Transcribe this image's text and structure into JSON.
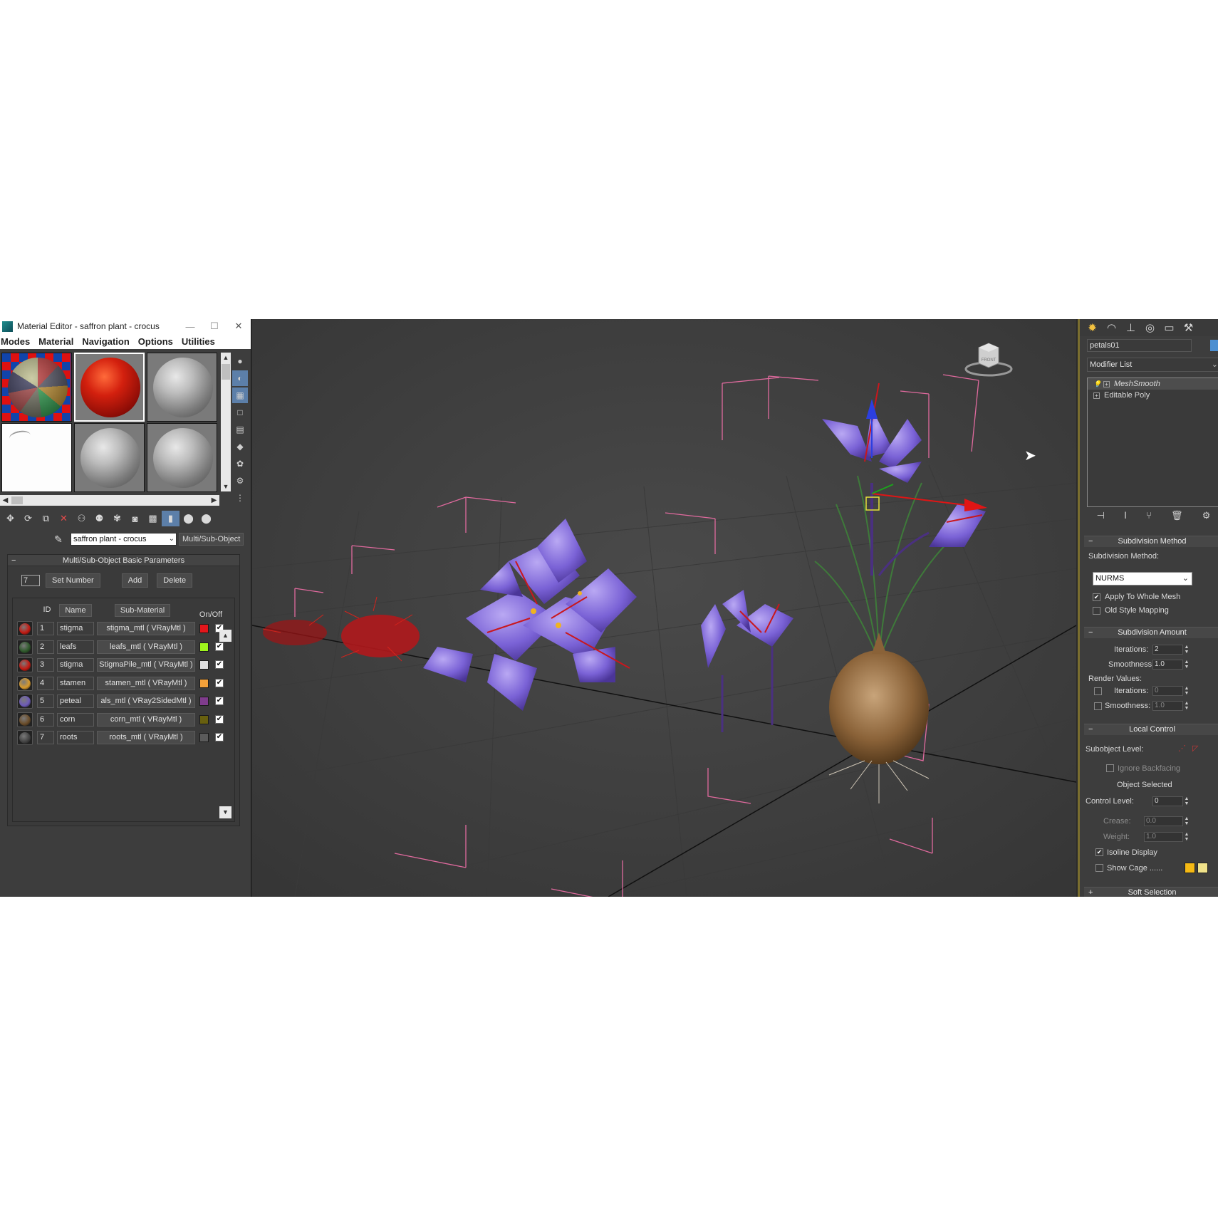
{
  "material_editor": {
    "title": "Material Editor - saffron plant - crocus",
    "window_buttons": [
      "—",
      "☐",
      "✕"
    ],
    "menu": [
      "Modes",
      "Material",
      "Navigation",
      "Options",
      "Utilities"
    ],
    "material_name": "saffron plant - crocus",
    "material_type": "Multi/Sub-Object",
    "rollout_title": "Multi/Sub-Object Basic Parameters",
    "count_value": "7",
    "set_number_label": "Set Number",
    "add_label": "Add",
    "delete_label": "Delete",
    "columns": {
      "id": "ID",
      "name": "Name",
      "sub_material": "Sub-Material",
      "on_off": "On/Off"
    },
    "rows": [
      {
        "id": "1",
        "name": "stigma",
        "sub": "stigma_mtl  ( VRayMtl )",
        "color": "#e4161b",
        "ball": "#c41a12",
        "checked": "✔"
      },
      {
        "id": "2",
        "name": "leafs",
        "sub": "leafs_mtl  ( VRayMtl )",
        "color": "#9ef41c",
        "ball": "#2f5a2b",
        "checked": "✔"
      },
      {
        "id": "3",
        "name": "stigma",
        "sub": "StigmaPile_mtl  ( VRayMtl )",
        "color": "#dddddd",
        "ball": "#c41a12",
        "checked": "✔"
      },
      {
        "id": "4",
        "name": "stamen",
        "sub": "stamen_mtl  ( VRayMtl )",
        "color": "#f3a13a",
        "ball": "#d79a2c",
        "checked": "✔"
      },
      {
        "id": "5",
        "name": "peteal",
        "sub": "als_mtl  ( VRay2SidedMtl )",
        "color": "#7f3c8c",
        "ball": "#6d5bb8",
        "checked": "✔"
      },
      {
        "id": "6",
        "name": "corn",
        "sub": "corn_mtl  ( VRayMtl )",
        "color": "#68600f",
        "ball": "#6b4d2a",
        "checked": "✔"
      },
      {
        "id": "7",
        "name": "roots",
        "sub": "roots_mtl  ( VRayMtl )",
        "color": "#5b5b5b",
        "ball": "#444444",
        "checked": "✔"
      }
    ]
  },
  "viewport": {
    "viewcube_label": "FRONT"
  },
  "command_panel": {
    "object_name": "petals01",
    "object_color": "#4c8fd1",
    "modifier_list_label": "Modifier List",
    "stack": [
      "MeshSmooth",
      "Editable Poly"
    ],
    "subdivision_method": {
      "title": "Subdivision Method",
      "label": "Subdivision Method:",
      "value": "NURMS",
      "apply_whole_mesh": "Apply To Whole Mesh",
      "apply_whole_mesh_checked": "✔",
      "old_style_mapping": "Old Style Mapping"
    },
    "subdivision_amount": {
      "title": "Subdivision Amount",
      "iterations_label": "Iterations:",
      "iterations": "2",
      "smoothness_label": "Smoothness:",
      "smoothness": "1.0",
      "render_values": "Render Values:",
      "render_iterations_label": "Iterations:",
      "render_iterations": "0",
      "render_smoothness_label": "Smoothness:",
      "render_smoothness": "1.0"
    },
    "local_control": {
      "title": "Local Control",
      "subobject_level": "Subobject Level:",
      "ignore_backfacing": "Ignore Backfacing",
      "object_selected": "Object Selected",
      "control_level_label": "Control Level:",
      "control_level": "0",
      "crease_label": "Crease:",
      "crease": "0.0",
      "weight_label": "Weight:",
      "weight": "1.0",
      "isoline_display": "Isoline Display",
      "isoline_checked": "✔",
      "show_cage": "Show Cage ......",
      "cage_color_1": "#f5b914",
      "cage_color_2": "#f0e28a"
    },
    "soft_selection": {
      "title": "Soft Selection"
    },
    "collapse_minus": "−",
    "expand_plus": "+"
  }
}
